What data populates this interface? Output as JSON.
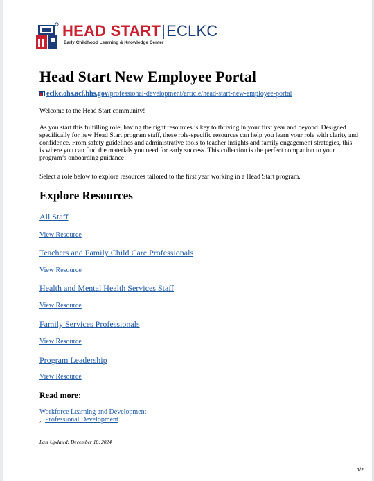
{
  "logo": {
    "head": "HEAD START",
    "separator": "|",
    "brand": "ECLKC",
    "subtitle": "Early Childhood Learning & Knowledge Center"
  },
  "title": "Head Start New Employee Portal",
  "source": {
    "domain": "eclkc.ohs.acf.hhs.gov",
    "path": "/professional-development/article/head-start-new-employee-portal"
  },
  "paragraphs": [
    "Welcome to the Head Start community!",
    "As you start this fulfilling role, having the right resources is key to thriving in your first year and beyond. Designed specifically for new Head Start program staff, these role-specific resources can help you learn your role with clarity and confidence. From safety guidelines and administrative tools to teacher insights and family engagement strategies, this is where you can find the materials you need for early success. This collection is the perfect companion to your program’s onboarding guidance!",
    "Select a role below to explore resources tailored to the first year working in a Head Start program."
  ],
  "explore_heading": "Explore Resources",
  "resources": [
    {
      "role": "All Staff",
      "link": "View Resource"
    },
    {
      "role": "Teachers and Family Child Care Professionals",
      "link": "View Resource"
    },
    {
      "role": "Health and Mental Health Services Staff",
      "link": "View Resource"
    },
    {
      "role": "Family Services Professionals",
      "link": "View Resource"
    },
    {
      "role": "Program Leadership",
      "link": "View Resource"
    }
  ],
  "read_more": {
    "heading": "Read more:",
    "tags": [
      "Workforce Learning and Development",
      "Professional Development"
    ],
    "separator": ","
  },
  "last_updated": "Last Updated: December 18, 2024",
  "page_number": "1/2",
  "colors": {
    "link": "#1f5aa6",
    "logo_red": "#c8202f",
    "logo_blue": "#1d3d7a"
  }
}
